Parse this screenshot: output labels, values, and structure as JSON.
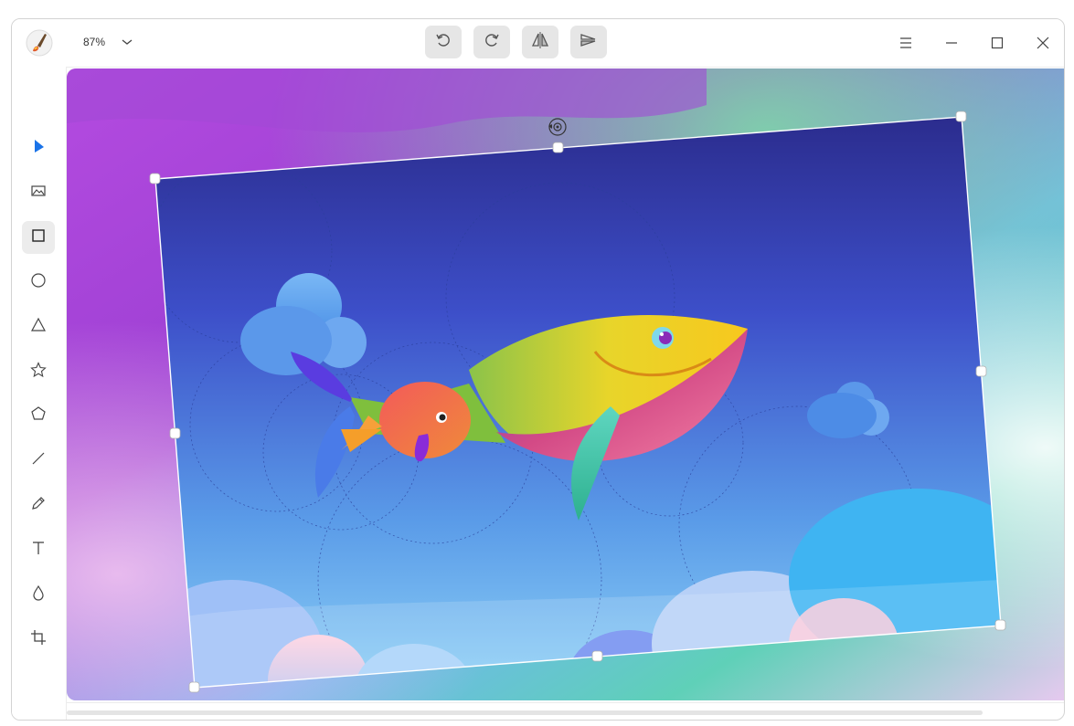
{
  "header": {
    "zoom_value": "87%"
  },
  "icons": {
    "app": "paintbrush-app-icon",
    "zoom_dropdown": "chevron-down-icon",
    "undo": "rotate-left-icon",
    "redo": "rotate-right-icon",
    "flip_horizontal": "flip-horizontal-icon",
    "flip_vertical": "flip-vertical-icon",
    "menu": "hamburger-menu-icon",
    "minimize": "minimize-icon",
    "maximize": "maximize-icon",
    "close": "close-icon"
  },
  "tools": [
    {
      "name": "select-tool",
      "icon": "cursor-icon",
      "active": false
    },
    {
      "name": "image-tool",
      "icon": "image-icon",
      "active": false
    },
    {
      "name": "rectangle-tool",
      "icon": "rectangle-icon",
      "active": true
    },
    {
      "name": "ellipse-tool",
      "icon": "circle-icon",
      "active": false
    },
    {
      "name": "triangle-tool",
      "icon": "triangle-icon",
      "active": false
    },
    {
      "name": "star-tool",
      "icon": "star-icon",
      "active": false
    },
    {
      "name": "polygon-tool",
      "icon": "pentagon-icon",
      "active": false
    },
    {
      "name": "line-tool",
      "icon": "line-icon",
      "active": false
    },
    {
      "name": "pencil-tool",
      "icon": "pencil-icon",
      "active": false
    },
    {
      "name": "text-tool",
      "icon": "text-icon",
      "active": false
    },
    {
      "name": "blur-tool",
      "icon": "drop-icon",
      "active": false
    },
    {
      "name": "crop-tool",
      "icon": "crop-icon",
      "active": false
    }
  ],
  "colors": {
    "accent": "#1a73e8",
    "selection_handle": "#ffffff",
    "toolbar_button_bg": "#e6e6e6"
  }
}
